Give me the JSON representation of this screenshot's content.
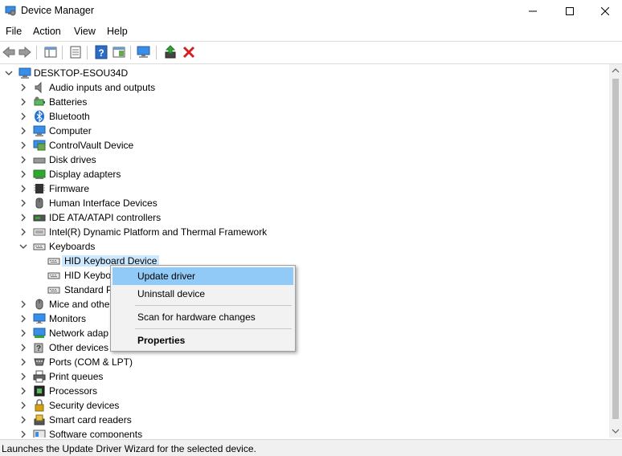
{
  "window": {
    "title": "Device Manager",
    "title_icon": "device-manager-icon",
    "controls": [
      "minimize-icon",
      "maximize-icon",
      "close-icon"
    ]
  },
  "menu": [
    {
      "label": "File"
    },
    {
      "label": "Action"
    },
    {
      "label": "View"
    },
    {
      "label": "Help"
    }
  ],
  "toolbar_icons": [
    "back-arrow-icon",
    "forward-arrow-icon",
    "show-hide-console-tree-icon",
    "properties-icon",
    "help-icon",
    "action-pane-icon",
    "scan-hardware-icon",
    "update-driver-icon",
    "uninstall-device-icon"
  ],
  "tree": {
    "root": "DESKTOP-ESOU34D",
    "categories": [
      {
        "label": "Audio inputs and outputs",
        "icon": "speaker-icon",
        "expanded": false
      },
      {
        "label": "Batteries",
        "icon": "battery-icon",
        "expanded": false
      },
      {
        "label": "Bluetooth",
        "icon": "bluetooth-icon",
        "expanded": false
      },
      {
        "label": "Computer",
        "icon": "computer-icon",
        "expanded": false
      },
      {
        "label": "ControlVault Device",
        "icon": "controlvault-icon",
        "expanded": false
      },
      {
        "label": "Disk drives",
        "icon": "disk-drive-icon",
        "expanded": false
      },
      {
        "label": "Display adapters",
        "icon": "display-adapter-icon",
        "expanded": false
      },
      {
        "label": "Firmware",
        "icon": "firmware-icon",
        "expanded": false
      },
      {
        "label": "Human Interface Devices",
        "icon": "hid-icon",
        "expanded": false
      },
      {
        "label": "IDE ATA/ATAPI controllers",
        "icon": "ide-controller-icon",
        "expanded": false
      },
      {
        "label": "Intel(R) Dynamic Platform and Thermal Framework",
        "icon": "thermal-framework-icon",
        "expanded": false
      },
      {
        "label": "Keyboards",
        "icon": "keyboard-icon",
        "expanded": true,
        "children": [
          {
            "label": "HID Keyboard Device",
            "selected": true
          },
          {
            "label": "HID Keybo",
            "selected": false
          },
          {
            "label": "Standard P",
            "selected": false
          }
        ]
      },
      {
        "label": "Mice and othe",
        "icon": "mouse-icon",
        "expanded": false
      },
      {
        "label": "Monitors",
        "icon": "monitor-icon",
        "expanded": false
      },
      {
        "label": "Network adap",
        "icon": "network-adapter-icon",
        "expanded": false
      },
      {
        "label": "Other devices",
        "icon": "unknown-device-icon",
        "expanded": false
      },
      {
        "label": "Ports (COM & LPT)",
        "icon": "port-icon",
        "expanded": false
      },
      {
        "label": "Print queues",
        "icon": "printer-icon",
        "expanded": false
      },
      {
        "label": "Processors",
        "icon": "processor-icon",
        "expanded": false
      },
      {
        "label": "Security devices",
        "icon": "security-device-icon",
        "expanded": false
      },
      {
        "label": "Smart card readers",
        "icon": "smart-card-reader-icon",
        "expanded": false
      },
      {
        "label": "Software components",
        "icon": "software-component-icon",
        "expanded": false
      }
    ]
  },
  "context_menu": {
    "items": [
      {
        "label": "Update driver",
        "highlighted": true
      },
      {
        "label": "Uninstall device"
      },
      {
        "label": "Scan for hardware changes"
      },
      {
        "label": "Properties",
        "bold": true
      }
    ]
  },
  "status_bar": {
    "text": "Launches the Update Driver Wizard for the selected device."
  },
  "colors": {
    "selection": "#cce8ff",
    "menu_highlight": "#91c9f7",
    "uninstall_red": "#d32020",
    "toolbar_blue": "#2b6cc4"
  }
}
